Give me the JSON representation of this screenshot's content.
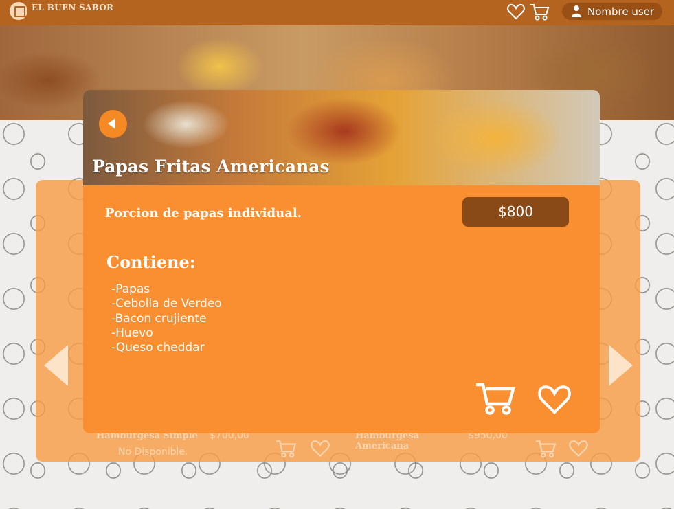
{
  "header": {
    "brand": "EL BUEN SABOR",
    "user_name": "Nombre user",
    "icons": [
      "heart-icon",
      "cart-icon",
      "user-icon"
    ]
  },
  "colors": {
    "header": "#b5641f",
    "accent": "#f98f30",
    "price_badge": "#8a4a18",
    "user_pill": "#9a5015"
  },
  "modal": {
    "title": "Papas Fritas Americanas",
    "description": "Porcion de papas individual.",
    "price": "$800",
    "contents_heading": "Contiene:",
    "ingredients": [
      "-Papas",
      "-Cebolla de Verdeo",
      "-Bacon crujiente",
      "-Huevo",
      "-Queso cheddar"
    ]
  },
  "background_cards": [
    {
      "name": "Hamburgesa Simple",
      "price": "$700,00",
      "status": "No Disponible."
    },
    {
      "name": "Hamburgesa Americana",
      "price": "$950,00",
      "status": ""
    }
  ]
}
